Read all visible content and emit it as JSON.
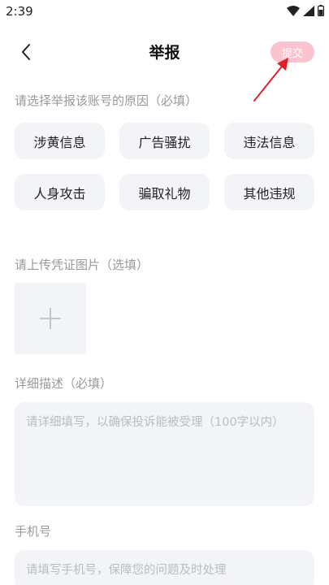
{
  "status_bar": {
    "time": "2:39",
    "icons": [
      "wifi-icon",
      "signal-icon",
      "battery-icon"
    ]
  },
  "header": {
    "title": "举报",
    "back_icon": "chevron-left-icon",
    "submit_label": "提交",
    "submit_color": "#fbc3cd"
  },
  "reason_section": {
    "label": "请选择举报该账号的原因（必填）",
    "options": [
      "涉黄信息",
      "广告骚扰",
      "违法信息",
      "人身攻击",
      "骗取礼物",
      "其他违规"
    ]
  },
  "upload_section": {
    "label": "请上传凭证图片（选填）",
    "add_icon": "plus-icon"
  },
  "description_section": {
    "label": "详细描述（必填）",
    "placeholder": "请详细填写，以确保投诉能被受理（100字以内）",
    "value": ""
  },
  "phone_section": {
    "label": "手机号",
    "placeholder": "请填写手机号，保障您的问题及时处理",
    "value": ""
  },
  "annotation": {
    "arrow_color": "#e0202a"
  }
}
